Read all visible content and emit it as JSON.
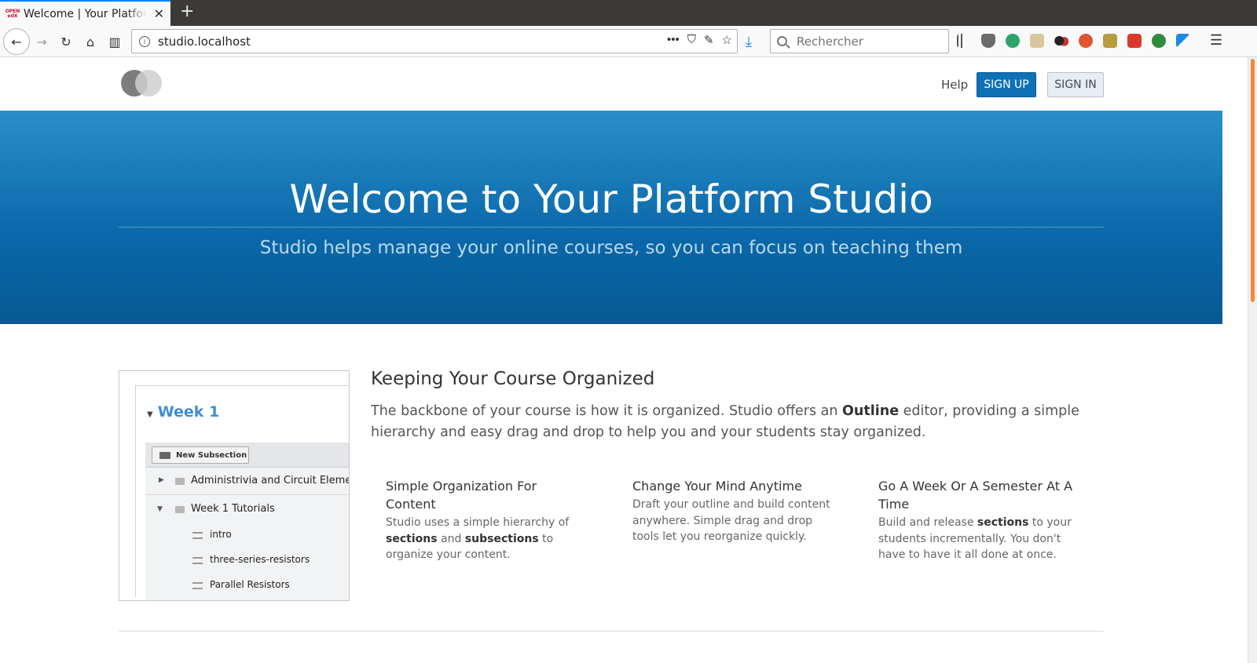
{
  "browser": {
    "tab_title": "Welcome | Your Platform Studio",
    "tab_close": "✕",
    "favicon_text": "OPEN edX",
    "new_tab": "+",
    "url": "studio.localhost",
    "url_actions": [
      "•••",
      "⛉",
      "✎",
      "☆"
    ],
    "search_placeholder": "Rechercher"
  },
  "header": {
    "help": "Help",
    "sign_up": "SIGN UP",
    "sign_in": "SIGN IN"
  },
  "hero": {
    "title": "Welcome to Your Platform Studio",
    "subtitle": "Studio helps manage your online courses, so you can focus on teaching them"
  },
  "outline_image": {
    "week": "Week 1",
    "new_subsection": "New Subsection",
    "rows": [
      "Administrivia and Circuit Elements",
      "Week 1 Tutorials",
      "intro",
      "three-series-resistors",
      "Parallel Resistors"
    ]
  },
  "feature": {
    "title": "Keeping Your Course Organized",
    "desc_1": "The backbone of your course is how it is organized. Studio offers an ",
    "desc_bold": "Outline",
    "desc_2": " editor, providing a simple hierarchy and easy drag and drop to help you and your students stay organized.",
    "col1_title": "Simple Organization For Content",
    "col1_a": "Studio uses a simple hierarchy of ",
    "col1_b1": "sections",
    "col1_c": " and ",
    "col1_b2": "subsections",
    "col1_d": " to organize your content.",
    "col2_title": "Change Your Mind Anytime",
    "col2_body": "Draft your outline and build content anywhere. Simple drag and drop tools let you reorganize quickly.",
    "col3_title": "Go A Week Or A Semester At A Time",
    "col3_a": "Build and release ",
    "col3_b": "sections",
    "col3_c": " to your students incrementally. You don't have to have it all done at once."
  },
  "colors": {
    "brand_blue": "#0f71b5",
    "hero_top": "#2a8fca",
    "hero_bottom": "#075a94",
    "outline_link": "#3d8ed3"
  }
}
